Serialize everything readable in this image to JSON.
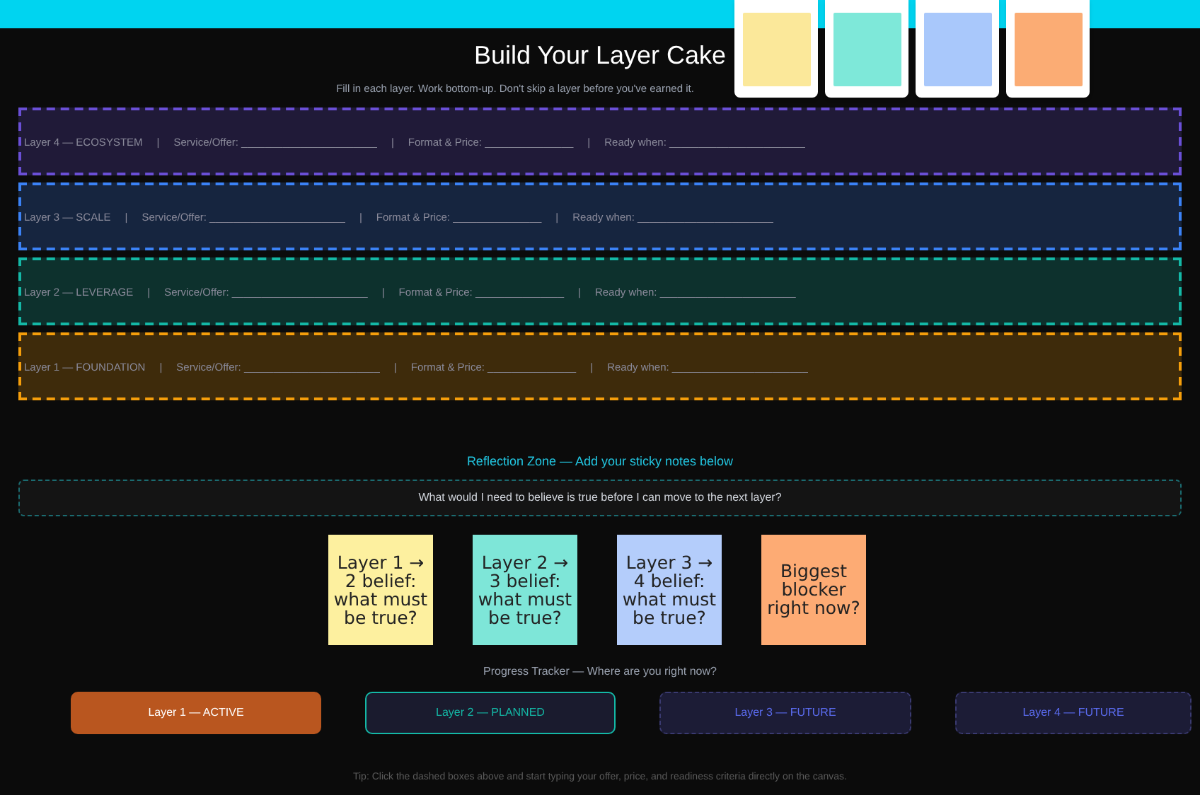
{
  "sticky_tray": [
    {
      "color": "#fbe89a"
    },
    {
      "color": "#7ee8d9"
    },
    {
      "color": "#a9c8fb"
    },
    {
      "color": "#fbac74"
    }
  ],
  "title": "Build Your Layer Cake",
  "subtitle": "Fill in each layer. Work bottom-up. Don't skip a layer before you've earned it.",
  "layers": [
    {
      "color": "#6a4fd6",
      "segments": [
        "Layer 4 — ECOSYSTEM",
        "|",
        "Service/Offer: _______________________",
        "|",
        "Format & Price: _______________",
        "|",
        "Ready when: _______________________"
      ]
    },
    {
      "color": "#3b82f6",
      "segments": [
        "Layer 3 — SCALE",
        "|",
        "Service/Offer: _______________________",
        "|",
        "Format & Price: _______________",
        "|",
        "Ready when: _______________________"
      ]
    },
    {
      "color": "#14b8a6",
      "segments": [
        "Layer 2 — LEVERAGE",
        "|",
        "Service/Offer: _______________________",
        "|",
        "Format & Price: _______________",
        "|",
        "Ready when: _______________________"
      ]
    },
    {
      "color": "#f59e0b",
      "segments": [
        "Layer 1 — FOUNDATION",
        "|",
        "Service/Offer: _______________________",
        "|",
        "Format & Price: _______________",
        "|",
        "Ready when: _______________________"
      ]
    }
  ],
  "reflection": {
    "title": "Reflection Zone — Add your sticky notes below",
    "prompt": "What would I need to believe is true before I can move to the next layer?"
  },
  "notes": [
    {
      "text": "Layer 1 → 2 belief: what must be true?",
      "color": "#fdf09f"
    },
    {
      "text": "Layer 2 → 3 belief: what must be true?",
      "color": "#7ee6d8"
    },
    {
      "text": "Layer 3 → 4 belief: what must be true?",
      "color": "#b4cdfb"
    },
    {
      "text": "Biggest blocker right now?",
      "color": "#fdab74"
    }
  ],
  "progress": {
    "title": "Progress Tracker — Where are you right now?",
    "stages": [
      {
        "label": "Layer 1 — ACTIVE",
        "kind": "active"
      },
      {
        "label": "Layer 2 — PLANNED",
        "kind": "planned"
      },
      {
        "label": "Layer 3 — FUTURE",
        "kind": "future"
      },
      {
        "label": "Layer 4 — FUTURE",
        "kind": "future"
      }
    ]
  },
  "tip": "Tip: Click the dashed boxes above and start typing your offer, price, and readiness criteria directly on the canvas."
}
